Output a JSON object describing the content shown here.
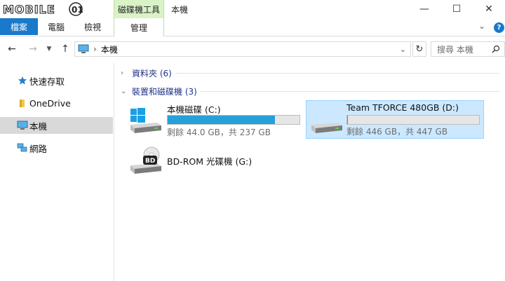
{
  "watermark": {
    "text": "MOBILE01"
  },
  "titlebar": {
    "tool_tab": "磁碟機工具",
    "window_title": "本機",
    "minimize": "—",
    "maximize": "☐",
    "close": "✕"
  },
  "ribbon": {
    "file_tab": "檔案",
    "tabs": [
      "電腦",
      "檢視"
    ],
    "manage_tab": "管理",
    "help": "?"
  },
  "address": {
    "path_root": "本機",
    "search_placeholder": "搜尋 本機"
  },
  "sidebar": {
    "items": [
      {
        "label": "快速存取",
        "icon": "star-icon"
      },
      {
        "label": "OneDrive",
        "icon": "folder-icon"
      },
      {
        "label": "本機",
        "icon": "computer-icon"
      },
      {
        "label": "網路",
        "icon": "network-icon"
      }
    ]
  },
  "content": {
    "groups": [
      {
        "label": "資料夾 (6)",
        "expanded": false
      },
      {
        "label": "裝置和磁碟機 (3)",
        "expanded": true
      }
    ],
    "drives": [
      {
        "name": "本機磁碟 (C:)",
        "free_text": "剩餘 44.0 GB，共 237 GB",
        "used_fraction": 0.814,
        "icon": "windows-drive-icon"
      },
      {
        "name": "Team TFORCE 480GB (D:)",
        "free_text": "剩餘 446 GB，共 447 GB",
        "used_fraction": 0.002,
        "icon": "hard-drive-icon"
      },
      {
        "name": "BD-ROM 光碟機 (G:)",
        "icon": "bd-rom-drive-icon"
      }
    ]
  },
  "colors": {
    "accent": "#1979ca",
    "progress_fill": "#26a0da",
    "selection": "#cce8ff",
    "tool_tab_bg": "#d9f2c6"
  }
}
